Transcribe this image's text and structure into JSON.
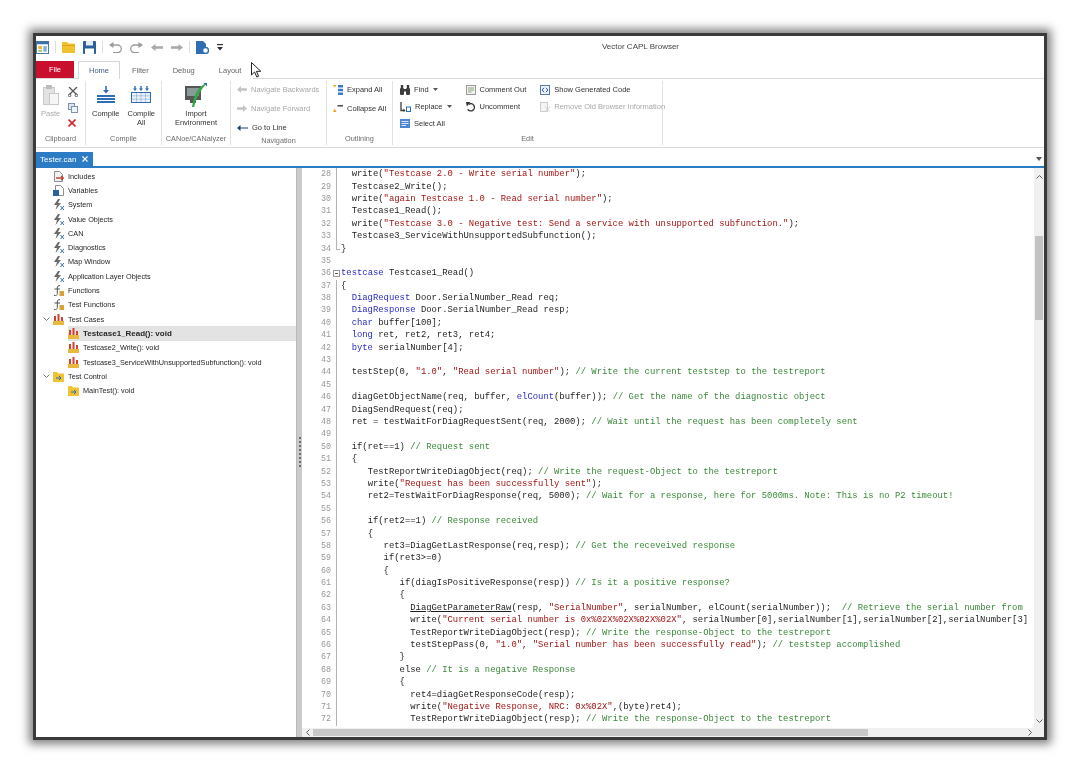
{
  "window": {
    "title": "Vector CAPL Browser"
  },
  "ribbon": {
    "tabs": [
      {
        "label": "File",
        "kind": "backstage",
        "selected": false
      },
      {
        "label": "Home",
        "kind": "tab",
        "selected": true
      },
      {
        "label": "Filter",
        "kind": "tab",
        "selected": false
      },
      {
        "label": "Debug",
        "kind": "tab",
        "selected": false
      },
      {
        "label": "Layout",
        "kind": "tab",
        "selected": false
      }
    ],
    "groups": [
      {
        "label": "Clipboard",
        "kind": "clipboard",
        "items": [
          {
            "label": "Paste",
            "disabled": true
          }
        ]
      },
      {
        "label": "Compile",
        "kind": "large",
        "items": [
          {
            "label": "Compile",
            "disabled": false
          },
          {
            "label": "Compile All",
            "disabled": false
          }
        ]
      },
      {
        "label": "CANoe/CANalyzer",
        "kind": "large",
        "items": [
          {
            "label": "Import Environment",
            "disabled": false
          }
        ]
      },
      {
        "label": "Navigation",
        "kind": "small",
        "items": [
          {
            "label": "Navigate Backwards",
            "disabled": true
          },
          {
            "label": "Navigate Forward",
            "disabled": true
          },
          {
            "label": "Go to Line",
            "disabled": false
          }
        ]
      },
      {
        "label": "Outlining",
        "kind": "small",
        "items": [
          {
            "label": "Expand All",
            "disabled": false
          },
          {
            "label": "Collapse All",
            "disabled": false
          }
        ]
      },
      {
        "label": "Edit",
        "kind": "columns",
        "columns": [
          {
            "items": [
              {
                "label": "Find",
                "disabled": false,
                "dropdown": true
              },
              {
                "label": "Replace",
                "disabled": false,
                "dropdown": true
              },
              {
                "label": "Select All",
                "disabled": false,
                "dropdown": false
              }
            ]
          },
          {
            "items": [
              {
                "label": "Comment Out",
                "disabled": false,
                "dropdown": false
              },
              {
                "label": "Uncomment",
                "disabled": false,
                "dropdown": false
              }
            ]
          },
          {
            "items": [
              {
                "label": "Show Generated Code",
                "disabled": false,
                "dropdown": false
              },
              {
                "label": "Remove Old Browser Information",
                "disabled": true,
                "dropdown": false
              }
            ]
          }
        ]
      }
    ]
  },
  "documents": [
    {
      "label": "Tester.can",
      "selected": true
    }
  ],
  "tree": {
    "items": [
      {
        "label": "Includes",
        "kind": "includes",
        "selected": false
      },
      {
        "label": "Variables",
        "kind": "variables",
        "selected": false
      },
      {
        "label": "System",
        "kind": "symbols",
        "selected": false
      },
      {
        "label": "Value Objects",
        "kind": "symbols",
        "selected": false
      },
      {
        "label": "CAN",
        "kind": "symbols",
        "selected": false
      },
      {
        "label": "Diagnostics",
        "kind": "symbols",
        "selected": false
      },
      {
        "label": "Map Window",
        "kind": "symbols",
        "selected": false
      },
      {
        "label": "Application Layer Objects",
        "kind": "symbols",
        "selected": false
      },
      {
        "label": "Functions",
        "kind": "functions",
        "selected": false
      },
      {
        "label": "Test Functions",
        "kind": "functions",
        "selected": false
      },
      {
        "label": "Test Cases",
        "kind": "testcases",
        "selected": false,
        "expanded": true,
        "children": [
          {
            "label": "Testcase1_Read(): void",
            "kind": "testcases",
            "selected": true
          },
          {
            "label": "Testcase2_Write(): void",
            "kind": "testcases",
            "selected": false
          },
          {
            "label": "Testcase3_ServiceWithUnsupportedSubfunction(): void",
            "kind": "testcases",
            "selected": false
          }
        ]
      },
      {
        "label": "Test Control",
        "kind": "control",
        "selected": false,
        "expanded": true,
        "children": [
          {
            "label": "MainTest(): void",
            "kind": "control",
            "selected": false
          }
        ]
      }
    ]
  },
  "editor": {
    "lines": [
      {
        "number": "28",
        "kind": "body",
        "tokens": [
          {
            "kind": "plain",
            "text": "  write("
          },
          {
            "kind": "string",
            "text": "\"Testcase 2.0 - Write serial number\""
          },
          {
            "kind": "plain",
            "text": ");"
          }
        ]
      },
      {
        "number": "29",
        "kind": "body",
        "tokens": [
          {
            "kind": "plain",
            "text": "  Testcase2_Write();"
          }
        ]
      },
      {
        "number": "30",
        "kind": "body",
        "tokens": [
          {
            "kind": "plain",
            "text": "  write("
          },
          {
            "kind": "string",
            "text": "\"again Testcase 1.0 - Read serial number\""
          },
          {
            "kind": "plain",
            "text": ");"
          }
        ]
      },
      {
        "number": "31",
        "kind": "body",
        "tokens": [
          {
            "kind": "plain",
            "text": "  Testcase1_Read();"
          }
        ]
      },
      {
        "number": "32",
        "kind": "body",
        "tokens": [
          {
            "kind": "plain",
            "text": "  write("
          },
          {
            "kind": "string",
            "text": "\"Testcase 3.0 - Negative test: Send a service with unsupported subfunction.\""
          },
          {
            "kind": "plain",
            "text": ");"
          }
        ]
      },
      {
        "number": "33",
        "kind": "body",
        "tokens": [
          {
            "kind": "plain",
            "text": "  Testcase3_ServiceWithUnsupportedSubfunction();"
          }
        ]
      },
      {
        "number": "34",
        "kind": "end",
        "tokens": [
          {
            "kind": "plain",
            "text": "}"
          }
        ]
      },
      {
        "number": "35",
        "kind": "blank"
      },
      {
        "number": "36",
        "kind": "header",
        "expanded": true,
        "tokens": [
          {
            "kind": "keyword",
            "text": "testcase"
          },
          {
            "kind": "plain",
            "text": " Testcase1_Read()"
          }
        ]
      },
      {
        "number": "37",
        "kind": "body",
        "tokens": [
          {
            "kind": "plain",
            "text": "{"
          }
        ]
      },
      {
        "number": "38",
        "kind": "body",
        "tokens": [
          {
            "kind": "keyword",
            "text": "  DiagRequest"
          },
          {
            "kind": "plain",
            "text": " Door.SerialNumber_Read req;"
          }
        ]
      },
      {
        "number": "39",
        "kind": "body",
        "tokens": [
          {
            "kind": "keyword",
            "text": "  DiagResponse"
          },
          {
            "kind": "plain",
            "text": " Door.SerialNumber_Read resp;"
          }
        ]
      },
      {
        "number": "40",
        "kind": "body",
        "tokens": [
          {
            "kind": "keyword",
            "text": "  char"
          },
          {
            "kind": "plain",
            "text": " buffer[100];"
          }
        ]
      },
      {
        "number": "41",
        "kind": "body",
        "tokens": [
          {
            "kind": "keyword",
            "text": "  long"
          },
          {
            "kind": "plain",
            "text": " ret, ret2, ret3, ret4;"
          }
        ]
      },
      {
        "number": "42",
        "kind": "body",
        "tokens": [
          {
            "kind": "keyword",
            "text": "  byte"
          },
          {
            "kind": "plain",
            "text": " serialNumber[4];"
          }
        ]
      },
      {
        "number": "43",
        "kind": "body"
      },
      {
        "number": "44",
        "kind": "body",
        "tokens": [
          {
            "kind": "plain",
            "text": "  testStep(0, "
          },
          {
            "kind": "string",
            "text": "\"1.0\""
          },
          {
            "kind": "plain",
            "text": ", "
          },
          {
            "kind": "string",
            "text": "\"Read serial number\""
          },
          {
            "kind": "plain",
            "text": "); "
          },
          {
            "kind": "comment",
            "text": "// Write the current teststep to the testreport"
          }
        ]
      },
      {
        "number": "45",
        "kind": "body"
      },
      {
        "number": "46",
        "kind": "body",
        "tokens": [
          {
            "kind": "plain",
            "text": "  diagGetObjectName(req, buffer, "
          },
          {
            "kind": "keyword",
            "text": "elCount"
          },
          {
            "kind": "plain",
            "text": "(buffer)); "
          },
          {
            "kind": "comment",
            "text": "// Get the name of the diagnostic object"
          }
        ]
      },
      {
        "number": "47",
        "kind": "body",
        "tokens": [
          {
            "kind": "plain",
            "text": "  DiagSendRequest(req);"
          }
        ]
      },
      {
        "number": "48",
        "kind": "body",
        "tokens": [
          {
            "kind": "plain",
            "text": "  ret = testWaitForDiagRequestSent(req, 2000); "
          },
          {
            "kind": "comment",
            "text": "// Wait until the request has been completely sent"
          }
        ]
      },
      {
        "number": "49",
        "kind": "body"
      },
      {
        "number": "50",
        "kind": "body",
        "tokens": [
          {
            "kind": "plain",
            "text": "  if(ret==1) "
          },
          {
            "kind": "comment",
            "text": "// Request sent"
          }
        ]
      },
      {
        "number": "51",
        "kind": "body",
        "tokens": [
          {
            "kind": "plain",
            "text": "  {"
          }
        ]
      },
      {
        "number": "52",
        "kind": "body",
        "tokens": [
          {
            "kind": "plain",
            "text": "     TestReportWriteDiagObject(req); "
          },
          {
            "kind": "comment",
            "text": "// Write the request-Object to the testreport"
          }
        ]
      },
      {
        "number": "53",
        "kind": "body",
        "tokens": [
          {
            "kind": "plain",
            "text": "     write("
          },
          {
            "kind": "string",
            "text": "\"Request has been successfully sent\""
          },
          {
            "kind": "plain",
            "text": ");"
          }
        ]
      },
      {
        "number": "54",
        "kind": "body",
        "tokens": [
          {
            "kind": "plain",
            "text": "     ret2=TestWaitForDiagResponse(req, 5000); "
          },
          {
            "kind": "comment",
            "text": "// Wait for a response, here for 5000ms. Note: This is no P2 timeout!"
          }
        ]
      },
      {
        "number": "55",
        "kind": "body"
      },
      {
        "number": "56",
        "kind": "body",
        "tokens": [
          {
            "kind": "plain",
            "text": "     if(ret2==1) "
          },
          {
            "kind": "comment",
            "text": "// Response received"
          }
        ]
      },
      {
        "number": "57",
        "kind": "body",
        "tokens": [
          {
            "kind": "plain",
            "text": "     {"
          }
        ]
      },
      {
        "number": "58",
        "kind": "body",
        "tokens": [
          {
            "kind": "plain",
            "text": "        ret3=DiagGetLastResponse(req,resp); "
          },
          {
            "kind": "comment",
            "text": "// Get the receveived response"
          }
        ]
      },
      {
        "number": "59",
        "kind": "body",
        "tokens": [
          {
            "kind": "plain",
            "text": "        if(ret3>=0)"
          }
        ]
      },
      {
        "number": "60",
        "kind": "body",
        "tokens": [
          {
            "kind": "plain",
            "text": "        {"
          }
        ]
      },
      {
        "number": "61",
        "kind": "body",
        "tokens": [
          {
            "kind": "plain",
            "text": "           if(diagIsPositiveResponse(resp)) "
          },
          {
            "kind": "comment",
            "text": "// Is it a positive response?"
          }
        ]
      },
      {
        "number": "62",
        "kind": "body",
        "tokens": [
          {
            "kind": "plain",
            "text": "           {"
          }
        ]
      },
      {
        "number": "63",
        "kind": "body",
        "tokens": [
          {
            "kind": "link",
            "text": "             DiagGetParameterRaw"
          },
          {
            "kind": "plain",
            "text": "(resp, "
          },
          {
            "kind": "string",
            "text": "\"SerialNumber\""
          },
          {
            "kind": "plain",
            "text": ", serialNumber, elCount(serialNumber));  "
          },
          {
            "kind": "comment",
            "text": "// Retrieve the serial number from"
          }
        ]
      },
      {
        "number": "64",
        "kind": "body",
        "tokens": [
          {
            "kind": "plain",
            "text": "             write("
          },
          {
            "kind": "string",
            "text": "\"Current serial number is 0x%02X%02X%02X%02X\""
          },
          {
            "kind": "plain",
            "text": ", serialNumber[0],serialNumber[1],serialNumber[2],serialNumber[3]"
          }
        ]
      },
      {
        "number": "65",
        "kind": "body",
        "tokens": [
          {
            "kind": "plain",
            "text": "             TestReportWriteDiagObject(resp); "
          },
          {
            "kind": "comment",
            "text": "// Write the response-Object to the testreport"
          }
        ]
      },
      {
        "number": "66",
        "kind": "body",
        "tokens": [
          {
            "kind": "plain",
            "text": "             testStepPass(0, "
          },
          {
            "kind": "string",
            "text": "\"1.0\""
          },
          {
            "kind": "plain",
            "text": ", "
          },
          {
            "kind": "string",
            "text": "\"Serial number has been successfully read\""
          },
          {
            "kind": "plain",
            "text": "); "
          },
          {
            "kind": "comment",
            "text": "// teststep accomplished"
          }
        ]
      },
      {
        "number": "67",
        "kind": "body",
        "tokens": [
          {
            "kind": "plain",
            "text": "           }"
          }
        ]
      },
      {
        "number": "68",
        "kind": "body",
        "tokens": [
          {
            "kind": "plain",
            "text": "           else "
          },
          {
            "kind": "comment",
            "text": "// It is a negative Response"
          }
        ]
      },
      {
        "number": "69",
        "kind": "body",
        "tokens": [
          {
            "kind": "plain",
            "text": "           {"
          }
        ]
      },
      {
        "number": "70",
        "kind": "body",
        "tokens": [
          {
            "kind": "plain",
            "text": "             ret4=diagGetResponseCode(resp);"
          }
        ]
      },
      {
        "number": "71",
        "kind": "body",
        "tokens": [
          {
            "kind": "plain",
            "text": "             write("
          },
          {
            "kind": "string",
            "text": "\"Negative Response, NRC: 0x%02X\""
          },
          {
            "kind": "plain",
            "text": ",(byte)ret4);"
          }
        ]
      },
      {
        "number": "72",
        "kind": "body",
        "tokens": [
          {
            "kind": "plain",
            "text": "             TestReportWriteDiagObject(resp); "
          },
          {
            "kind": "comment",
            "text": "// Write the response-Object to the testreport"
          }
        ]
      }
    ]
  }
}
